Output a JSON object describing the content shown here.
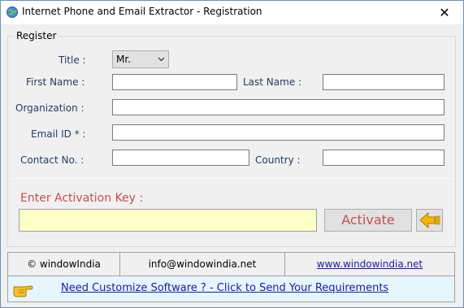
{
  "window": {
    "title": "Internet Phone and Email Extractor - Registration",
    "close_glyph": "✕",
    "app_icon": "globe-icon"
  },
  "register": {
    "legend": "Register",
    "title_label": "Title :",
    "title_value": "Mr.",
    "first_name_label": "First Name :",
    "first_name_value": "",
    "last_name_label": "Last Name :",
    "last_name_value": "",
    "organization_label": "Organization :",
    "organization_value": "",
    "email_label": "Email ID * :",
    "email_value": "",
    "contact_label": "Contact No. :",
    "contact_value": "",
    "country_label": "Country :",
    "country_value": ""
  },
  "activation": {
    "label": "Enter Activation Key  :",
    "value": "",
    "button_label": "Activate",
    "back_icon": "back-arrow-icon"
  },
  "footer": {
    "copyright": "© windowIndia",
    "email": "info@windowindia.net",
    "website": "www.windowindia.net"
  },
  "banner": {
    "icon": "pointing-hand-icon",
    "text": "Need Customize Software ? - Click to Send Your Requirements"
  },
  "colors": {
    "label_text": "#1f3d63",
    "activation_text": "#c0504d",
    "activation_field_bg": "#ffffc8",
    "link": "#1a1aa6",
    "banner_bg": "#e6f6ff"
  }
}
